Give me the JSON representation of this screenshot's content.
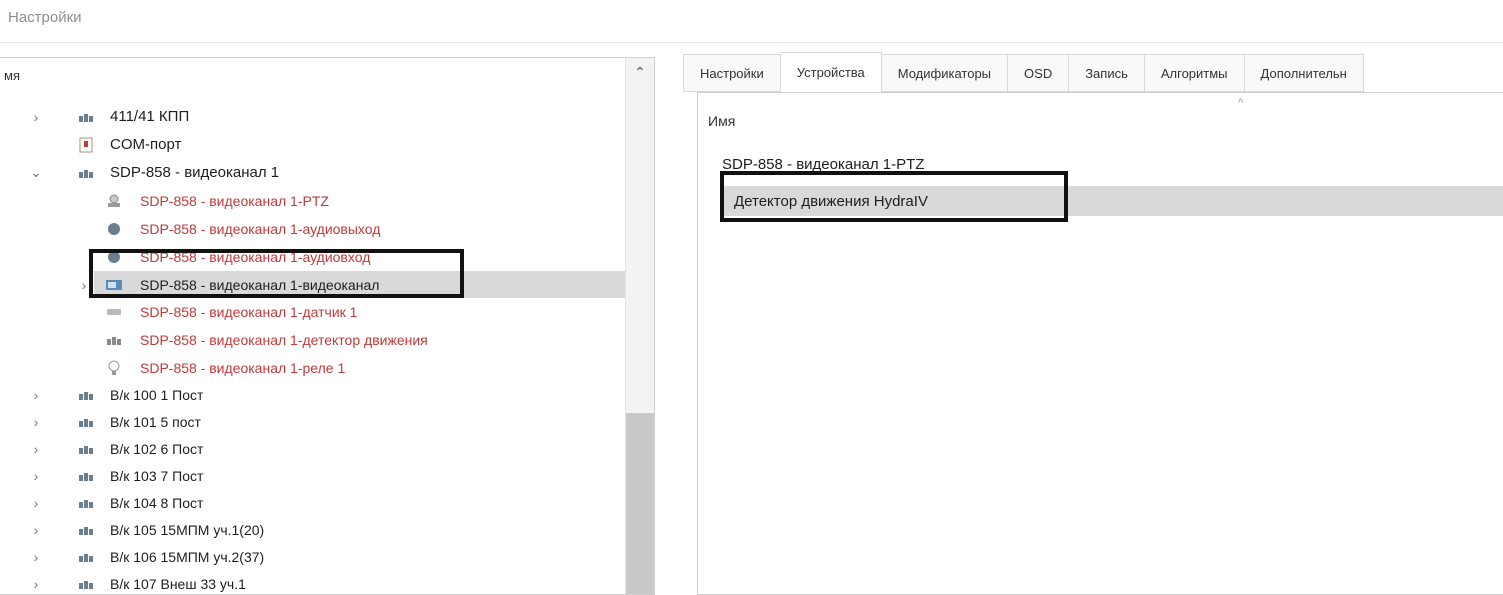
{
  "window": {
    "title": "Настройки"
  },
  "tree": {
    "header": "мя",
    "items": [
      {
        "label": "411/41 КПП",
        "chevron": ">",
        "icon": "camera-group-icon",
        "red": false,
        "selected": false
      },
      {
        "label": "COM-порт",
        "chevron": "",
        "icon": "com-port-icon",
        "red": false,
        "selected": false
      },
      {
        "label": "SDP-858 - видеоканал 1",
        "chevron": "v",
        "icon": "camera-group-icon",
        "red": false,
        "selected": false
      },
      {
        "label": "SDP-858 - видеоканал 1-PTZ",
        "chevron": "",
        "icon": "ptz-icon",
        "red": true,
        "selected": false
      },
      {
        "label": "SDP-858 - видеоканал 1-аудиовыход",
        "chevron": "",
        "icon": "audio-out-icon",
        "red": true,
        "selected": false
      },
      {
        "label": "SDP-858 - видеоканал 1-аудиовход",
        "chevron": "",
        "icon": "audio-in-icon",
        "red": true,
        "selected": false
      },
      {
        "label": "SDP-858 - видеоканал 1-видеоканал",
        "chevron": ">",
        "icon": "video-channel-icon",
        "red": false,
        "selected": true
      },
      {
        "label": "SDP-858 - видеоканал 1-датчик 1",
        "chevron": "",
        "icon": "sensor-icon",
        "red": true,
        "selected": false
      },
      {
        "label": "SDP-858 - видеоканал 1-детектор движения",
        "chevron": "",
        "icon": "motion-detector-icon",
        "red": true,
        "selected": false
      },
      {
        "label": "SDP-858 - видеоканал 1-реле 1",
        "chevron": "",
        "icon": "relay-icon",
        "red": true,
        "selected": false
      },
      {
        "label": "В/к 100 1 Пост",
        "chevron": ">",
        "icon": "camera-group-icon",
        "red": false,
        "selected": false
      },
      {
        "label": "В/к 101 5 пост",
        "chevron": ">",
        "icon": "camera-group-icon",
        "red": false,
        "selected": false
      },
      {
        "label": "В/к 102 6 Пост",
        "chevron": ">",
        "icon": "camera-group-icon",
        "red": false,
        "selected": false
      },
      {
        "label": "В/к 103 7 Пост",
        "chevron": ">",
        "icon": "camera-group-icon",
        "red": false,
        "selected": false
      },
      {
        "label": "В/к 104 8 Пост",
        "chevron": ">",
        "icon": "camera-group-icon",
        "red": false,
        "selected": false
      },
      {
        "label": "В/к 105 15МПМ уч.1(20)",
        "chevron": ">",
        "icon": "camera-group-icon",
        "red": false,
        "selected": false
      },
      {
        "label": "В/к 106 15МПМ уч.2(37)",
        "chevron": ">",
        "icon": "camera-group-icon",
        "red": false,
        "selected": false
      },
      {
        "label": "В/к 107 Внеш 33 уч.1",
        "chevron": ">",
        "icon": "camera-group-icon",
        "red": false,
        "selected": false
      }
    ]
  },
  "tabs": [
    {
      "label": "Настройки",
      "active": false
    },
    {
      "label": "Устройства",
      "active": true
    },
    {
      "label": "Модификаторы",
      "active": false
    },
    {
      "label": "OSD",
      "active": false
    },
    {
      "label": "Запись",
      "active": false
    },
    {
      "label": "Алгоритмы",
      "active": false
    },
    {
      "label": "Дополнительн",
      "active": false
    }
  ],
  "devices": {
    "column_header": "Имя",
    "rows": [
      {
        "label": "SDP-858 - видеоканал 1-PTZ",
        "selected": false
      },
      {
        "label": "Детектор движения HydraIV",
        "selected": true
      }
    ]
  },
  "colors": {
    "red_item": "#c0393b",
    "selection": "#d9d9d9",
    "highlight_box": "#111111"
  }
}
